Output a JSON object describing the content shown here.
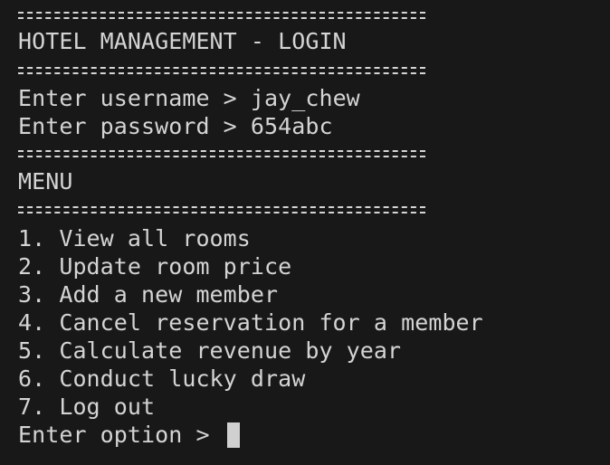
{
  "terminal": {
    "header_title": "HOTEL MANAGEMENT - LOGIN",
    "username_prompt": "Enter username > ",
    "username_value": "jay_chew",
    "password_prompt": "Enter password > ",
    "password_value": "654abc",
    "menu_title": "MENU",
    "menu_items": [
      "1. View all rooms",
      "2. Update room price",
      "3. Add a new member",
      "4. Cancel reservation for a member",
      "5. Calculate revenue by year",
      "6. Conduct lucky draw",
      "7. Log out"
    ],
    "option_prompt": "Enter option > ",
    "option_value": ""
  }
}
